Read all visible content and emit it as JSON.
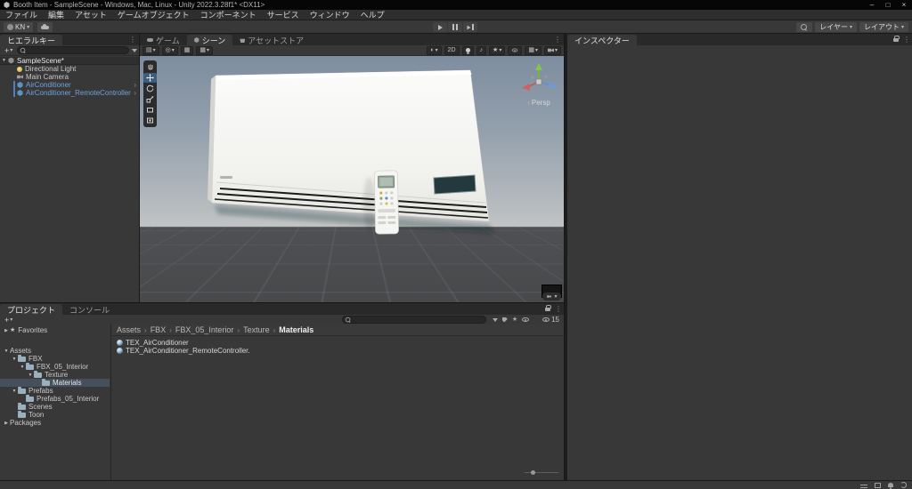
{
  "window": {
    "title": "Booth Item - SampleScene - Windows, Mac, Linux - Unity 2022.3.28f1* <DX11>"
  },
  "menubar": {
    "items": [
      "ファイル",
      "編集",
      "アセット",
      "ゲームオブジェクト",
      "コンポーネント",
      "サービス",
      "ウィンドウ",
      "ヘルプ"
    ]
  },
  "toolbar": {
    "account_label": "KN",
    "layers_label": "レイヤー",
    "layout_label": "レイアウト"
  },
  "hierarchy": {
    "tab_label": "ヒエラルキー",
    "scene_row": "SampleScene*",
    "items": [
      {
        "label": "Directional Light"
      },
      {
        "label": "Main Camera"
      },
      {
        "label": "AirConditioner"
      },
      {
        "label": "AirConditioner_RemoteController"
      }
    ]
  },
  "scene": {
    "tabs": [
      "ゲーム",
      "シーン",
      "アセットストア"
    ],
    "mode_2d_label": "2D",
    "persp_label": "Persp"
  },
  "inspector": {
    "tab_label": "インスペクター"
  },
  "project": {
    "tab_label": "プロジェクト",
    "console_tab_label": "コンソール",
    "favorites_label": "Favorites",
    "hidden_count": "15",
    "tree": [
      {
        "label": "Assets"
      },
      {
        "label": "FBX"
      },
      {
        "label": "FBX_05_Interior"
      },
      {
        "label": "Texture"
      },
      {
        "label": "Materials"
      },
      {
        "label": "Prefabs"
      },
      {
        "label": "Prefabs_05_Interior"
      },
      {
        "label": "Scenes"
      },
      {
        "label": "Toon"
      },
      {
        "label": "Packages"
      }
    ],
    "breadcrumb": [
      "Assets",
      "FBX",
      "FBX_05_Interior",
      "Texture",
      "Materials"
    ],
    "items": [
      {
        "label": "TEX_AirConditioner"
      },
      {
        "label": "TEX_AirConditioner_RemoteController."
      }
    ]
  },
  "icons": {
    "minimize": "–",
    "maximize": "□",
    "close": "×",
    "caret_down": "▾",
    "collapse_open": "▼",
    "collapse_closed": "▶",
    "kebab": "⋮",
    "chevron_right": "›",
    "plus": "+",
    "star": "★",
    "audio_note": "♪",
    "shaded_sphere": "◐",
    "grid": "▦",
    "pivot": "◎",
    "tool_panel": "▤",
    "persp_arrow": "‹"
  }
}
